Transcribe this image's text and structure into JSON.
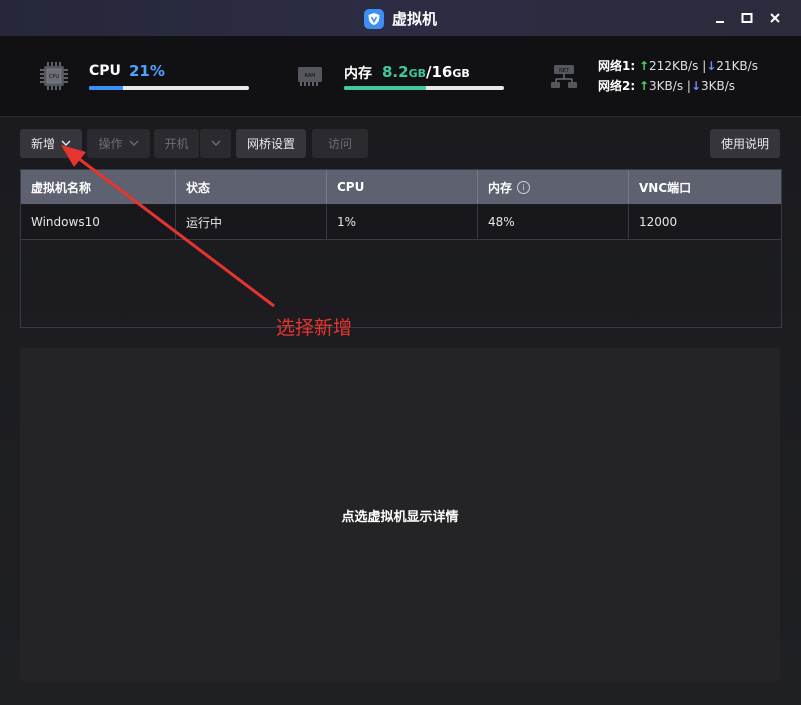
{
  "window": {
    "title": "虚拟机",
    "app_icon": "shield-v-icon",
    "controls": [
      "minimize-icon",
      "maximize-icon",
      "close-icon"
    ]
  },
  "stats": {
    "cpu": {
      "label": "CPU",
      "value": "21%",
      "percent": 21,
      "bar_color": "#3d8ef5"
    },
    "memory": {
      "label": "内存",
      "used_num": "8.2",
      "used_unit": "GB",
      "sep": "/",
      "total_num": "16",
      "total_unit": "GB",
      "percent": 51,
      "bar_color": "#3fc7a0"
    },
    "network": [
      {
        "label": "网络1:",
        "up": "212KB/s",
        "sep": "|",
        "down": "21KB/s"
      },
      {
        "label": "网络2:",
        "up": "3KB/s",
        "sep": "|",
        "down": "3KB/s"
      }
    ]
  },
  "toolbar": {
    "new_label": "新增",
    "ops_label": "操作",
    "power_label": "开机",
    "bridge_label": "网桥设置",
    "visit_label": "访问",
    "help_label": "使用说明"
  },
  "table": {
    "columns": [
      "虚拟机名称",
      "状态",
      "CPU",
      "内存",
      "VNC端口"
    ],
    "rows": [
      [
        "Windows10",
        "运行中",
        "1%",
        "48%",
        "12000"
      ]
    ]
  },
  "detail": {
    "placeholder": "点选虚拟机显示详情"
  },
  "annotation": {
    "text": "选择新增",
    "color": "#e8342f"
  }
}
